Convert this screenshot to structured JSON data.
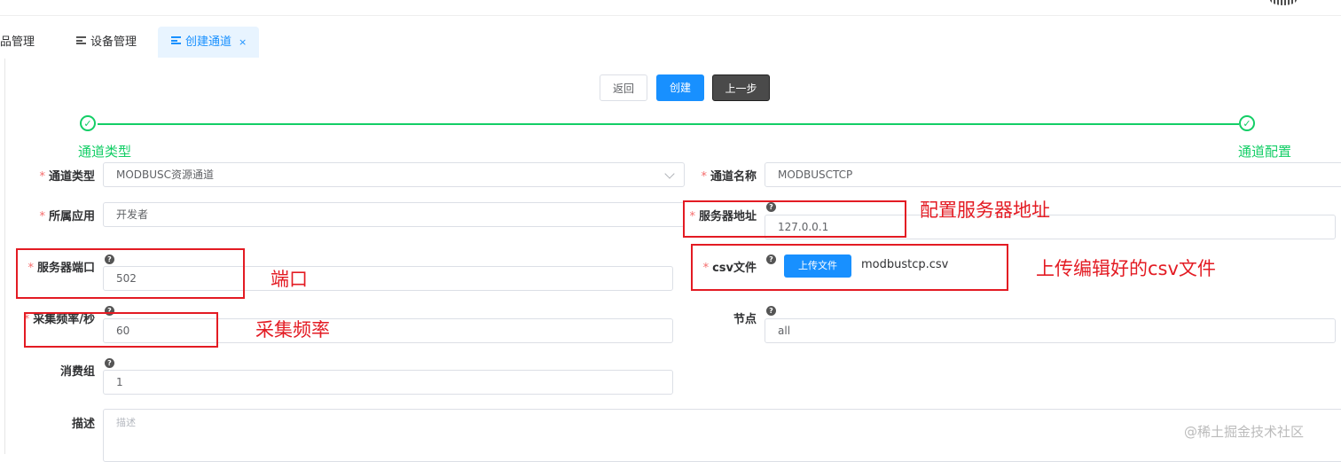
{
  "tabs": [
    {
      "label": "品管理"
    },
    {
      "label": "设备管理"
    },
    {
      "label": "创建通道",
      "close": "×"
    }
  ],
  "actions": {
    "back": "返回",
    "create": "创建",
    "prev": "上一步"
  },
  "steps": [
    {
      "title": "通道类型",
      "icon": "✓"
    },
    {
      "title": "通道配置",
      "icon": "✓"
    }
  ],
  "form": {
    "channel_type": {
      "label": "通道类型",
      "value": "MODBUSC资源通道"
    },
    "channel_name": {
      "label": "通道名称",
      "value": "MODBUSCTCP"
    },
    "app": {
      "label": "所属应用",
      "value": "开发者"
    },
    "server_addr": {
      "label": "服务器地址",
      "value": "127.0.0.1"
    },
    "server_port": {
      "label": "服务器端口",
      "value": "502"
    },
    "csv": {
      "label": "csv文件",
      "upload_label": "上传文件",
      "file_name": "modbustcp.csv"
    },
    "freq": {
      "label": "采集频率/秒",
      "value": "60"
    },
    "node": {
      "label": "节点",
      "value": "all"
    },
    "consumer": {
      "label": "消费组",
      "value": "1"
    },
    "desc": {
      "label": "描述",
      "placeholder": "描述"
    },
    "required_mark": "*",
    "help_mark": "?"
  },
  "annotations": {
    "server_addr": "配置服务器地址",
    "port": "端口",
    "csv": "上传编辑好的csv文件",
    "freq": "采集频率"
  },
  "watermark": "@稀土掘金技术社区",
  "colors": {
    "primary": "#1890ff",
    "success": "#13ce66",
    "annotation": "#e31b23",
    "required": "#f56c6c"
  }
}
